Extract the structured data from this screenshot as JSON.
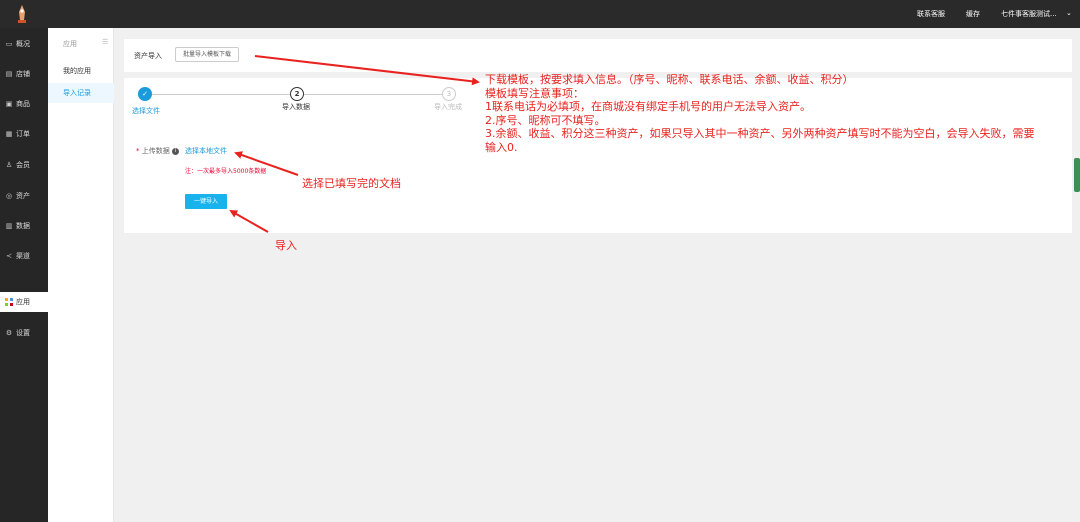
{
  "header": {
    "links": [
      "联系客服",
      "缓存",
      "七件事客服测试..."
    ],
    "dropdown_icon": "chevron-down-icon"
  },
  "sidebar": {
    "items": [
      {
        "label": "概况",
        "icon": "monitor-icon"
      },
      {
        "label": "店铺",
        "icon": "store-icon"
      },
      {
        "label": "商品",
        "icon": "goods-icon"
      },
      {
        "label": "订单",
        "icon": "order-icon"
      },
      {
        "label": "会员",
        "icon": "member-icon"
      },
      {
        "label": "资产",
        "icon": "asset-icon"
      },
      {
        "label": "数据",
        "icon": "data-icon"
      },
      {
        "label": "渠道",
        "icon": "channel-icon"
      },
      {
        "label": "应用",
        "icon": "app-icon",
        "active": true
      },
      {
        "label": "设置",
        "icon": "settings-icon"
      }
    ]
  },
  "subnav": {
    "title": "应用",
    "items": [
      "我的应用",
      "导入记录"
    ],
    "active_index": 1
  },
  "top_panel": {
    "label": "资产导入",
    "download_button": "批量导入模板下载"
  },
  "steps": [
    {
      "number": "✓",
      "label": "选择文件",
      "state": "done"
    },
    {
      "number": "2",
      "label": "导入数据",
      "state": "current"
    },
    {
      "number": "3",
      "label": "导入完成",
      "state": "pending"
    }
  ],
  "form": {
    "upload_label": "上传数据",
    "choose_file": "选择本地文件",
    "note": "注：一次最多导入5000条数据",
    "import_button": "一键导入"
  },
  "annotations": {
    "template_lines": [
      "下载模板，按要求填入信息。（序号、昵称、联系电话、余额、收益、积分）",
      "模板填写注意事项：",
      "1联系电话为必填项，在商城没有绑定手机号的用户无法导入资产。",
      "2.序号、昵称可不填写。",
      "3.余额、收益、积分这三种资产，如果只导入其中一种资产、另外两种资产填写时不能为空白，会导入失败，需要",
      "输入0."
    ],
    "choose_doc": "选择已填写完的文档",
    "import": "导入"
  },
  "colors": {
    "accent": "#1a9bdc",
    "primary_button": "#18b3ec",
    "annotation": "#e8231f",
    "sidebar_bg": "#262626"
  }
}
